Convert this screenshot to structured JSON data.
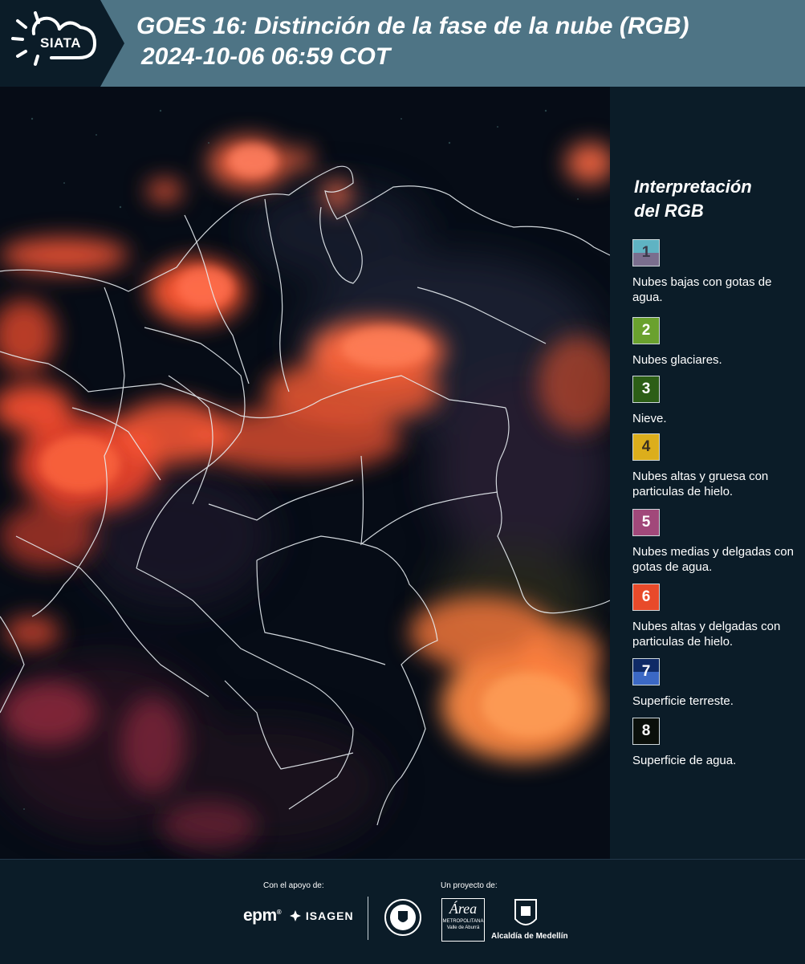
{
  "header": {
    "logo_text": "SIATA",
    "title_line1": "GOES 16: Distinción de la fase de la nube (RGB)",
    "title_line2": "2024-10-06 06:59 COT"
  },
  "legend": {
    "title_line1": "Interpretación",
    "title_line2": "del RGB",
    "items": [
      {
        "num": "1",
        "label": "Nubes bajas con gotas de agua.",
        "color_top": "#5fb3c3",
        "color_bottom": "#7a6e8e"
      },
      {
        "num": "2",
        "label": "Nubes glaciares.",
        "color_top": "#6aa12e",
        "color_bottom": "#6aa12e"
      },
      {
        "num": "3",
        "label": "Nieve.",
        "color_top": "#2c5e16",
        "color_bottom": "#2c5e16"
      },
      {
        "num": "4",
        "label": "Nubes altas y gruesa con particulas de hielo.",
        "color_top": "#dcae1c",
        "color_bottom": "#dcae1c"
      },
      {
        "num": "5",
        "label": "Nubes medias y delgadas con gotas de agua.",
        "color_top": "#a1487a",
        "color_bottom": "#a1487a"
      },
      {
        "num": "6",
        "label": "Nubes altas y delgadas con particulas de hielo.",
        "color_top": "#e84a2a",
        "color_bottom": "#e84a2a"
      },
      {
        "num": "7",
        "label": "Superficie terreste.",
        "color_top": "#0f2a66",
        "color_bottom": "#3b68c4"
      },
      {
        "num": "8",
        "label": "Superficie de agua.",
        "color_top": "#0a0f0a",
        "color_bottom": "#0a0f0a"
      }
    ]
  },
  "footer": {
    "support_label": "Con el apoyo de:",
    "project_label": "Un proyecto de:",
    "epm": "epm",
    "isagen": "ISAGEN",
    "area_line1": "Área",
    "area_line2": "METROPOLITANA",
    "area_line3": "Valle de Aburrá",
    "alcaldia": "Alcaldía de Medellín"
  }
}
